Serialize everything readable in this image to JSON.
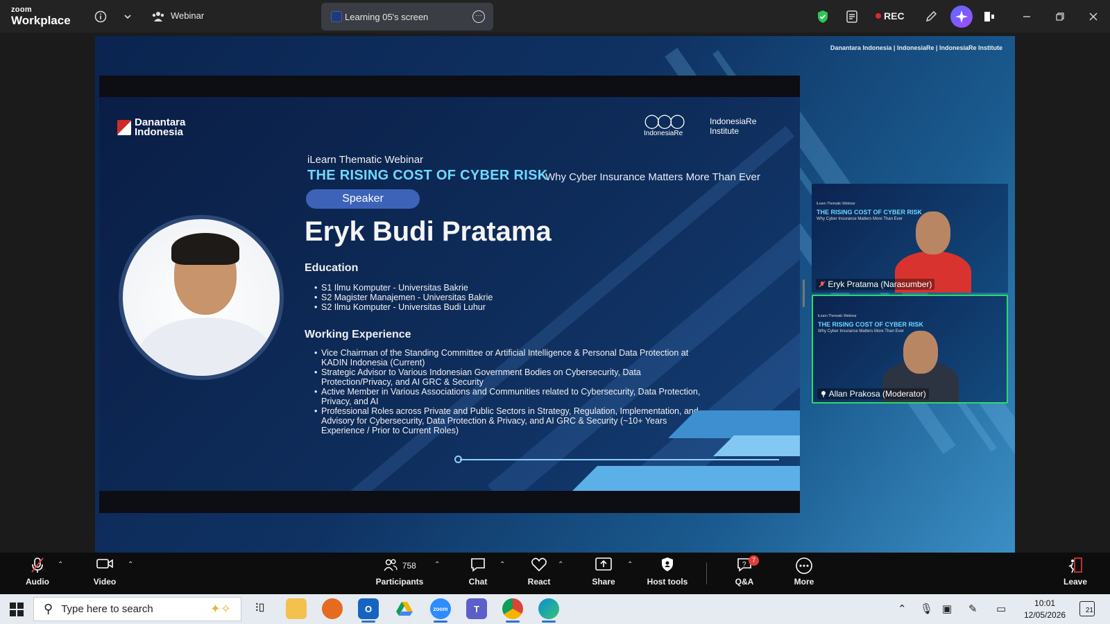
{
  "topbar": {
    "brand_small": "zoom",
    "brand_big": "Workplace",
    "meeting_type": "Webinar",
    "share_label": "Learning 05's screen",
    "rec_label": "REC"
  },
  "share_header_logos": "Danantara Indonesia | IndonesiaRe | IndonesiaRe Institute",
  "slide": {
    "logo_danantara": "Danantara Indonesia",
    "logo_indonesiare": "IndonesiaRe",
    "logo_institute": "IndonesiaRe Institute",
    "kicker": "iLearn Thematic Webinar",
    "title": "THE RISING COST OF CYBER RISK",
    "subtitle": "Why Cyber Insurance Matters More Than Ever",
    "speaker_tag": "Speaker",
    "speaker_name": "Eryk Budi Pratama",
    "education_heading": "Education",
    "education": [
      "S1 Ilmu Komputer - Universitas Bakrie",
      "S2 Magister Manajemen - Universitas Bakrie",
      "S2 Ilmu Komputer - Universitas Budi Luhur"
    ],
    "experience_heading": "Working Experience",
    "experience": [
      "Vice Chairman of the Standing Committee or Artificial Intelligence & Personal Data Protection at KADIN Indonesia (Current)",
      "Strategic Advisor to Various Indonesian Government Bodies on Cybersecurity, Data Protection/Privacy, and AI GRC & Security",
      "Active Member in Various Associations and Communities related to Cybersecurity, Data Protection, Privacy, and AI",
      "Professional Roles across Private and Public Sectors in Strategy, Regulation, Implementation, and Advisory for Cybersecurity, Data Protection & Privacy, and AI GRC & Security (~10+ Years Experience / Prior to Current Roles)"
    ]
  },
  "tiles": [
    {
      "name": "Eryk Pratama (Narasumber)",
      "mini_kicker": "iLearn Thematic Webinar",
      "mini_title": "THE RISING COST OF CYBER RISK",
      "mini_sub": "Why Cyber Insurance Matters More Than Ever",
      "active": false
    },
    {
      "name": "Allan Prakosa (Moderator)",
      "mini_kicker": "iLearn Thematic Webinar",
      "mini_title": "THE RISING COST OF CYBER RISK",
      "mini_sub": "Why Cyber Insurance Matters More Than Ever",
      "active": true
    }
  ],
  "toolbar": {
    "audio": "Audio",
    "video": "Video",
    "participants": "Participants",
    "participants_count": "758",
    "chat": "Chat",
    "react": "React",
    "share": "Share",
    "host_tools": "Host tools",
    "qa": "Q&A",
    "qa_badge": "7",
    "more": "More",
    "leave": "Leave"
  },
  "taskbar": {
    "search_placeholder": "Type here to search",
    "time": "10:01",
    "date": "12/05/2026",
    "notifications": "21"
  },
  "colors": {
    "accent_title": "#6fd8ff",
    "active_tile_border": "#2bdc63",
    "rec_dot": "#e02828",
    "speaker_pill": "#3d63b8"
  }
}
